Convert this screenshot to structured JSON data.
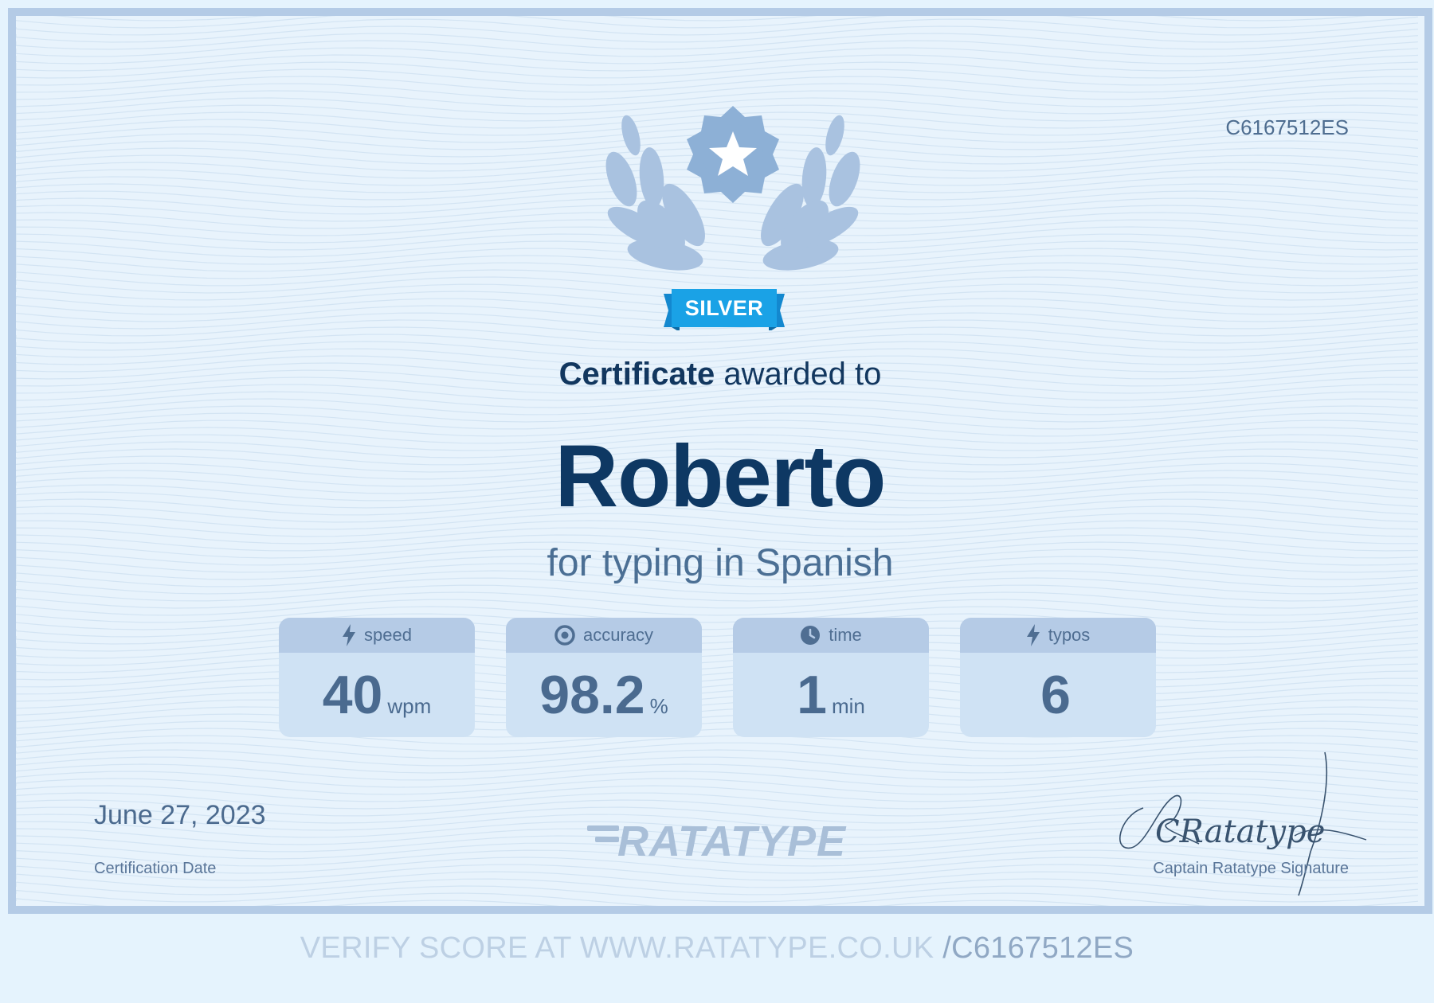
{
  "certificate": {
    "code": "C6167512ES",
    "level_badge": "SILVER",
    "awarded_bold": "Certificate",
    "awarded_rest": " awarded to",
    "recipient": "Roberto",
    "subject": "for typing in Spanish"
  },
  "stats": [
    {
      "label": "speed",
      "value": "40",
      "unit": "wpm",
      "icon": "lightning-icon"
    },
    {
      "label": "accuracy",
      "value": "98.2",
      "unit": "%",
      "icon": "target-icon"
    },
    {
      "label": "time",
      "value": "1",
      "unit": "min",
      "icon": "clock-icon"
    },
    {
      "label": "typos",
      "value": "6",
      "unit": "",
      "icon": "lightning-icon"
    }
  ],
  "footer": {
    "date": "June 27, 2023",
    "date_label": "Certification Date",
    "logo": "RATATYPE",
    "signature_text": "CRatatype",
    "signature_label": "Captain Ratatype Signature"
  },
  "verify": {
    "prefix": "VERIFY SCORE AT WWW.RATATYPE.CO.UK ",
    "code": "/C6167512ES"
  },
  "colors": {
    "background": "#e8f3fc",
    "border": "#b4cbe6",
    "name": "#0e3863",
    "ribbon": "#1aa2e6",
    "badge": "#8db0d6"
  }
}
